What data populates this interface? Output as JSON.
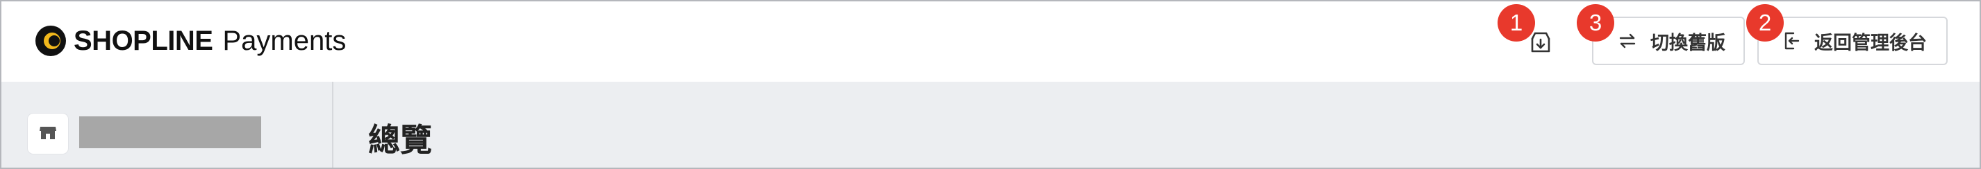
{
  "header": {
    "logo": {
      "text_bold": "SHOPLINE",
      "text_light": "Payments"
    },
    "download": {
      "icon": "download-icon"
    },
    "switch_button": {
      "label": "切換舊版",
      "icon": "swap-arrows-icon"
    },
    "back_button": {
      "label": "返回管理後台",
      "icon": "exit-icon"
    }
  },
  "annotations": {
    "badge_download": "1",
    "badge_switch": "3",
    "badge_back": "2",
    "badge_color": "#e8392c"
  },
  "sidebar": {
    "store_icon": "store-icon"
  },
  "main": {
    "title": "總覽"
  },
  "colors": {
    "header_bg": "#ffffff",
    "content_bg": "#eceef1",
    "border": "#d6d8dc"
  }
}
